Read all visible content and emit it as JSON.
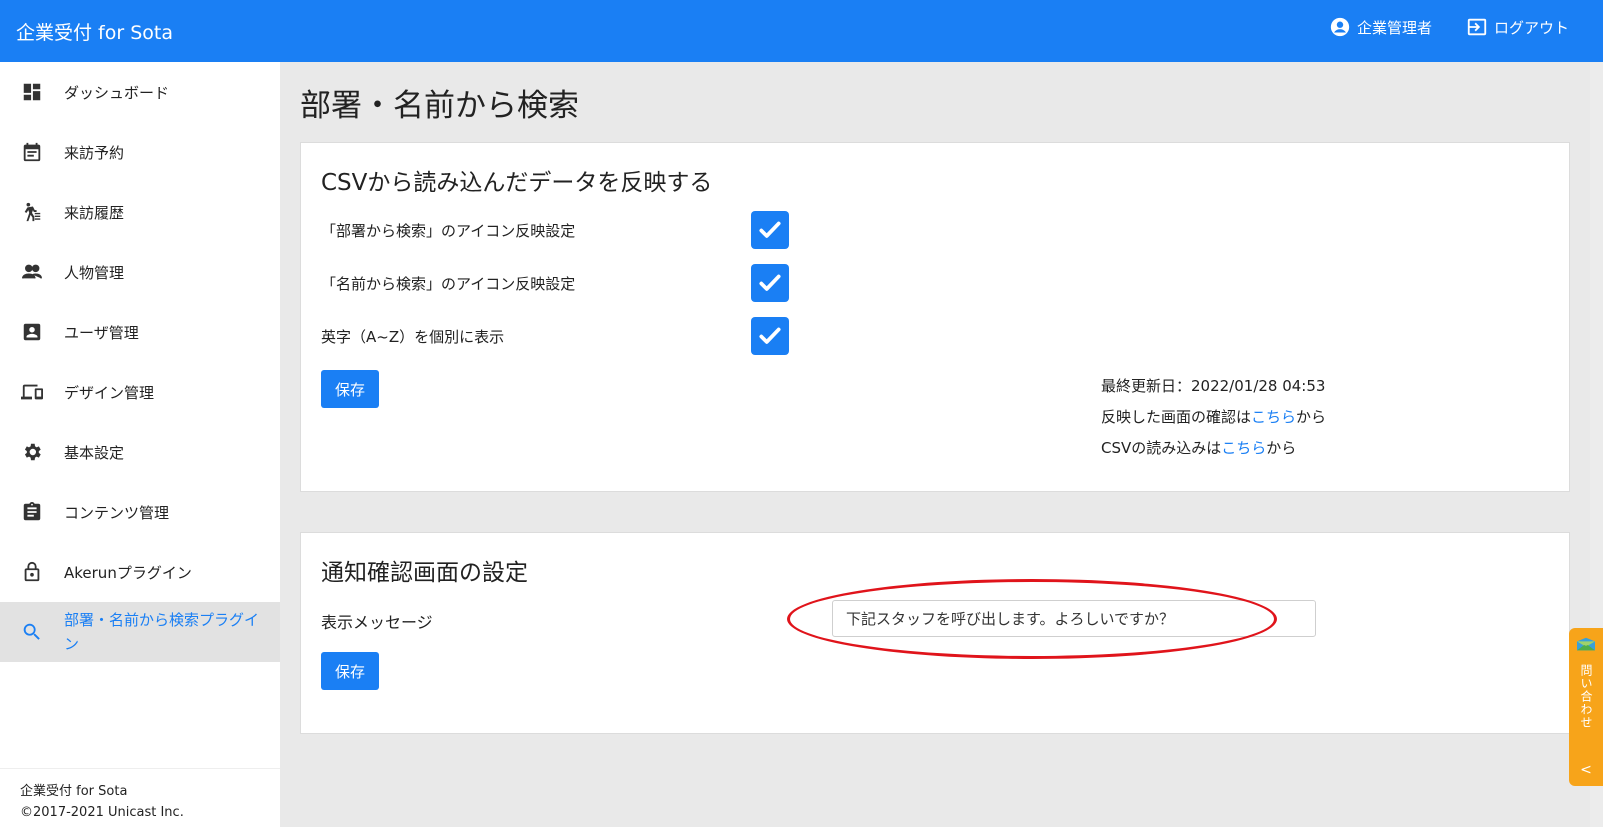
{
  "header": {
    "brand": "企業受付 for Sota",
    "user_label": "企業管理者",
    "logout_label": "ログアウト"
  },
  "sidebar": {
    "items": [
      {
        "label": "ダッシュボード",
        "icon": "dashboard-icon"
      },
      {
        "label": "来訪予約",
        "icon": "calendar-icon"
      },
      {
        "label": "来訪履歴",
        "icon": "walking-history-icon"
      },
      {
        "label": "人物管理",
        "icon": "people-icon"
      },
      {
        "label": "ユーザ管理",
        "icon": "account-box-icon"
      },
      {
        "label": "デザイン管理",
        "icon": "devices-icon"
      },
      {
        "label": "基本設定",
        "icon": "gear-icon"
      },
      {
        "label": "コンテンツ管理",
        "icon": "clipboard-icon"
      },
      {
        "label": "Akerunプラグイン",
        "icon": "lock-icon"
      },
      {
        "label": "部署・名前から検索プラグイン",
        "icon": "search-icon",
        "active": true
      }
    ],
    "footer": {
      "line1": "企業受付 for Sota",
      "line2": "©2017-2021 Unicast Inc."
    }
  },
  "main": {
    "page_title": "部署・名前から検索",
    "csv_card": {
      "title": "CSVから読み込んだデータを反映する",
      "settings": [
        {
          "label": "「部署から検索」のアイコン反映設定",
          "checked": true
        },
        {
          "label": "「名前から検索」のアイコン反映設定",
          "checked": true
        },
        {
          "label": "英字（A~Z）を個別に表示",
          "checked": true
        }
      ],
      "save_label": "保存",
      "last_updated": "最終更新日：2022/01/28 04:53",
      "confirm_prefix": "反映した画面の確認は",
      "confirm_link": "こちら",
      "confirm_suffix": "から",
      "csv_prefix": "CSVの読み込みは",
      "csv_link": "こちら",
      "csv_suffix": "から"
    },
    "notify_card": {
      "title": "通知確認画面の設定",
      "message_label": "表示メッセージ",
      "message_value": "下記スタッフを呼び出します。よろしいですか？",
      "save_label": "保存"
    }
  },
  "contact_tab": {
    "label": "問い合わせ",
    "chevron": "<"
  },
  "colors": {
    "primary": "#1a7ff4",
    "highlight": "#e0141b",
    "contact": "#f7a41a"
  }
}
